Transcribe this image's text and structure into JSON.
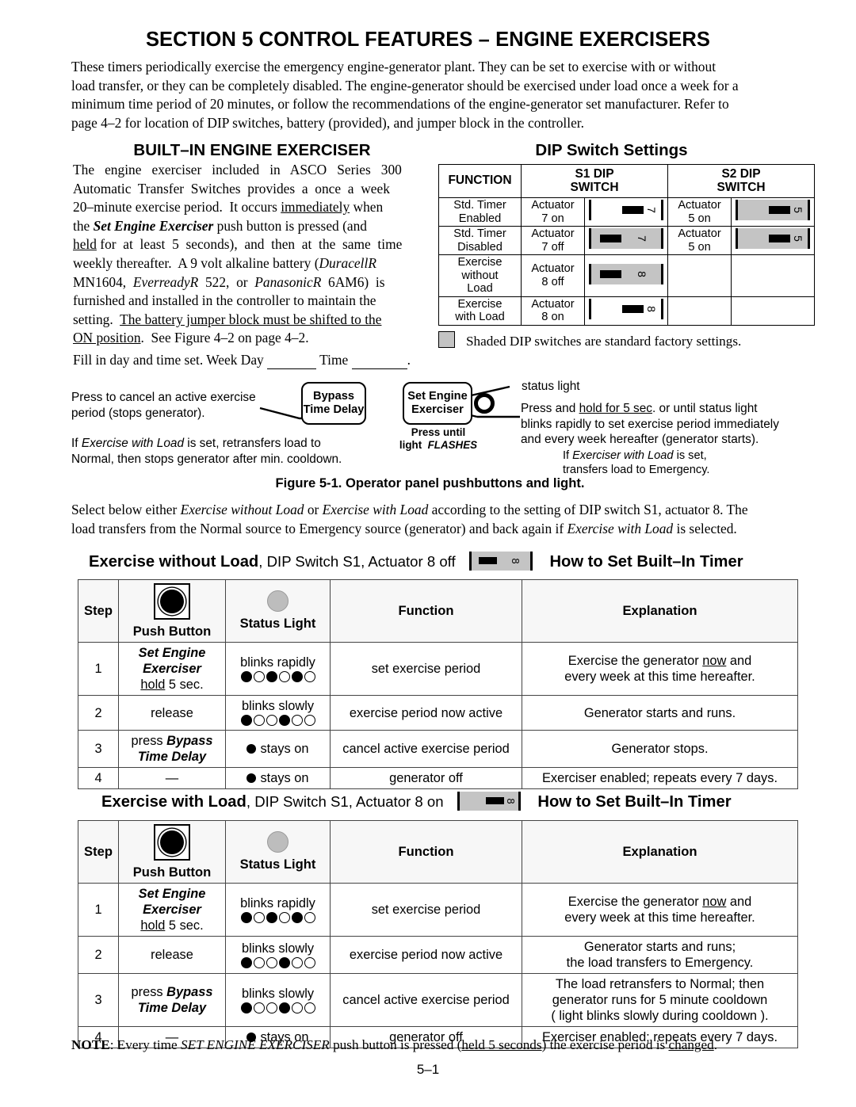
{
  "document": {
    "section_title": "SECTION 5  CONTROL FEATURES – ENGINE EXERCISERS",
    "page_number": "5–1"
  },
  "intro": {
    "lines": [
      "These timers periodically exercise the emergency engine-generator plant.  They can be set to exercise with or without",
      "load transfer, or they can be completely disabled.  The engine-generator should be exercised under load once a week for a",
      "minimum time period of 20 minutes, or follow the recommendations of the engine-generator set manufacturer.  Refer to",
      "page 4–2 for location of DIP switches, battery (provided), and jumper block in the controller."
    ]
  },
  "built_in": {
    "heading": "BUILT–IN ENGINE EXERCISER",
    "lines": [
      "The engine exerciser included in ASCO Series 300",
      "Automatic Transfer Switches provides a once a week",
      "20–minute exercise period.  It occurs immediately when",
      "the Set Engine Exerciser push button is pressed (and",
      "held for at least 5 seconds), and then at the same time",
      "weekly thereafter.  A 9 volt alkaline battery (DuracellR",
      "MN1604, EverreadyR 522, or PanasonicR 6AM6) is",
      "furnished and installed in the controller to maintain the",
      "setting.  The battery jumper block must be shifted to the",
      "ON position.  See Figure 4–2 on page 4–2."
    ],
    "fill_in_prefix": "Fill in day and time set.  Week Day",
    "fill_in_middle": "Time",
    "fill_in_suffix": "."
  },
  "dip_settings": {
    "heading": "DIP Switch Settings",
    "columns": [
      "FUNCTION",
      "S1 DIP SWITCH",
      "S2 DIP SWITCH"
    ],
    "col_headers": {
      "function": "FUNCTION",
      "s1_line1": "S1 DIP",
      "s1_line2": "SWITCH",
      "s2_line1": "S2 DIP",
      "s2_line2": "SWITCH"
    },
    "rows": [
      {
        "function_line1": "Std. Timer",
        "function_line2": "Enabled",
        "s1_actuator_line1": "Actuator",
        "s1_actuator_line2": "7 on",
        "s1_icon": {
          "number": "7",
          "state": "on",
          "shaded": false
        },
        "s2_actuator_line1": "Actuator",
        "s2_actuator_line2": "5 on",
        "s2_icon": {
          "number": "5",
          "state": "on",
          "shaded": true
        }
      },
      {
        "function_line1": "Std. Timer",
        "function_line2": "Disabled",
        "s1_actuator_line1": "Actuator",
        "s1_actuator_line2": "7 off",
        "s1_icon": {
          "number": "7",
          "state": "off",
          "shaded": true
        },
        "s2_actuator_line1": "Actuator",
        "s2_actuator_line2": "5 on",
        "s2_icon": {
          "number": "5",
          "state": "on",
          "shaded": true
        }
      },
      {
        "function_line1": "Exercise",
        "function_line2": "without",
        "function_line3": "Load",
        "s1_actuator_line1": "Actuator",
        "s1_actuator_line2": "8 off",
        "s1_icon": {
          "number": "8",
          "state": "off",
          "shaded": true
        },
        "s2_actuator_line1": "",
        "s2_actuator_line2": "",
        "s2_icon": null
      },
      {
        "function_line1": "Exercise",
        "function_line2": "with Load",
        "s1_actuator_line1": "Actuator",
        "s1_actuator_line2": "8 on",
        "s1_icon": {
          "number": "8",
          "state": "on",
          "shaded": false
        },
        "s2_actuator_line1": "",
        "s2_actuator_line2": "",
        "s2_icon": null
      }
    ],
    "legend": "Shaded DIP switches are standard factory settings."
  },
  "figure": {
    "caption": "Figure 5-1. Operator panel pushbuttons and light.",
    "bypass_button": {
      "line1": "Bypass",
      "line2": "Time Delay"
    },
    "bypass_note_line1": "Press to cancel an active exercise",
    "bypass_note_line2": "period (stops generator).",
    "bypass_note2_line1": "If Exercise with Load is set, retransfers load to",
    "bypass_note2_line2": "Normal, then stops generator after min. cooldown.",
    "set_button": {
      "line1": "Set Engine",
      "line2": "Exerciser"
    },
    "set_button_sub_line1": "Press until",
    "set_button_sub_line2": "light  FLASHES",
    "status_light_label": "status light",
    "status_note_line1": "Press and hold for 5 sec. or until status light",
    "status_note_line2": "blinks rapidly to set exercise period immediately",
    "status_note_line3": "and every week hereafter (generator starts).",
    "status_note2_line1": "If Exerciser with Load is set,",
    "status_note2_line2": "transfers load to Emergency."
  },
  "select_para": {
    "lines": [
      "Select below either Exercise without Load or Exercise with Load according to the setting of DIP switch S1, actuator 8. The",
      "load transfers from the Normal source to Emergency source (generator) and back again if Exercise with Load is selected."
    ]
  },
  "procedures": [
    {
      "id": "without-load",
      "heading_title": "Exercise without Load",
      "heading_rest": ", DIP Switch S1, Actuator 8 off",
      "heading_icon": {
        "number": "8",
        "state": "off",
        "shaded": true
      },
      "heading_howto": "How to Set Built–In Timer",
      "headers": {
        "step": "Step",
        "push_button": "Push Button",
        "status_light": "Status Light",
        "function": "Function",
        "explanation": "Explanation"
      },
      "rows": [
        {
          "step": "1",
          "push_button_line1": "Set Engine",
          "push_button_line2": "Exerciser",
          "push_button_line3": "hold 5 sec.",
          "status_text": "blinks rapidly",
          "status_pattern": "fefefe",
          "function": "set exercise period",
          "explanation_line1": "Exercise the generator now and",
          "explanation_line2": "every week at this time hereafter."
        },
        {
          "step": "2",
          "push_button_line1": "release",
          "status_text": "blinks slowly",
          "status_pattern": "feefee",
          "function": "exercise period now active",
          "explanation_line1": "Generator starts and runs."
        },
        {
          "step": "3",
          "push_button_line1": "press Bypass",
          "push_button_line2": "Time Delay",
          "status_text": "stays on",
          "status_pattern": "solid",
          "function": "cancel active exercise period",
          "explanation_line1": "Generator stops."
        },
        {
          "step": "4",
          "push_button_line1": "—",
          "status_text": "stays on",
          "status_pattern": "solid",
          "function": "generator off",
          "explanation_line1": "Exerciser enabled; repeats every 7 days."
        }
      ]
    },
    {
      "id": "with-load",
      "heading_title": "Exercise with Load",
      "heading_rest": ", DIP Switch S1, Actuator 8 on",
      "heading_icon": {
        "number": "8",
        "state": "on",
        "shaded": true
      },
      "heading_howto": "How to Set Built–In Timer",
      "headers": {
        "step": "Step",
        "push_button": "Push Button",
        "status_light": "Status Light",
        "function": "Function",
        "explanation": "Explanation"
      },
      "rows": [
        {
          "step": "1",
          "push_button_line1": "Set Engine",
          "push_button_line2": "Exerciser",
          "push_button_line3": "hold 5 sec.",
          "status_text": "blinks rapidly",
          "status_pattern": "fefefe",
          "function": "set exercise period",
          "explanation_line1": "Exercise the generator now and",
          "explanation_line2": "every week at this time hereafter."
        },
        {
          "step": "2",
          "push_button_line1": "release",
          "status_text": "blinks slowly",
          "status_pattern": "feefee",
          "function": "exercise period now active",
          "explanation_line1": "Generator starts and runs;",
          "explanation_line2": "the load transfers to Emergency."
        },
        {
          "step": "3",
          "push_button_line1": "press Bypass",
          "push_button_line2": "Time Delay",
          "status_text": "blinks slowly",
          "status_pattern": "feefee",
          "function": "cancel active exercise period",
          "explanation_line1": "The load retransfers to Normal; then",
          "explanation_line2": "generator runs for 5 minute cooldown",
          "explanation_line3": "( light blinks slowly during cooldown )."
        },
        {
          "step": "4",
          "push_button_line1": "—",
          "status_text": "stays on",
          "status_pattern": "solid",
          "function": "generator off",
          "explanation_line1": "Exerciser enabled; repeats every 7 days."
        }
      ]
    }
  ],
  "note": {
    "label": "NOTE",
    "text_a": ": Every time ",
    "emph": "SET ENGINE EXERCISER",
    "text_b": " push button is pressed (",
    "under_a": "held 5 seconds",
    "text_c": ") the exercise period is ",
    "under_b": "changed",
    "text_d": "."
  },
  "colors": {
    "shaded_dip": "#c4c4c4",
    "status_light_header": "#bdbdbd",
    "table_header_bg": "#f7f7f7",
    "ink": "#000000"
  }
}
